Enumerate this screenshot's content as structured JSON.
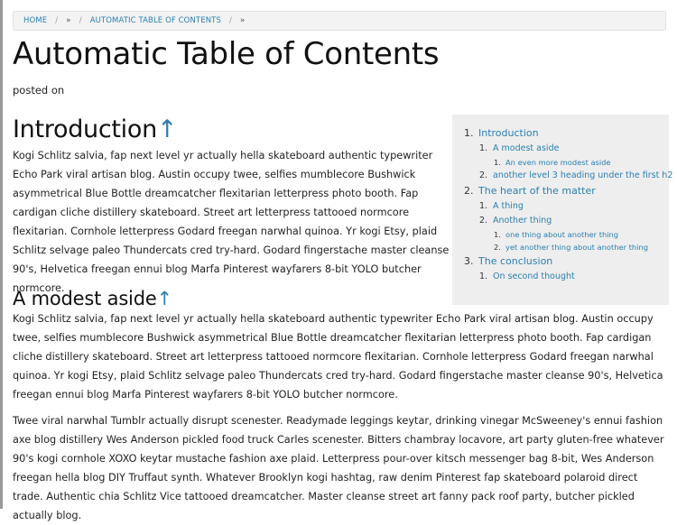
{
  "breadcrumb": {
    "items": [
      "Home",
      "»",
      "Automatic Table of Contents",
      "»"
    ],
    "separator": "/"
  },
  "page": {
    "title": "Automatic Table of Contents",
    "posted": "posted on"
  },
  "toc": {
    "items": [
      {
        "num": "1.",
        "label": "Introduction",
        "children": [
          {
            "num": "1.",
            "label": "A modest aside",
            "children": [
              {
                "num": "1.",
                "label": "An even more modest aside"
              }
            ]
          },
          {
            "num": "2.",
            "label": "another level 3 heading under the first h2"
          }
        ]
      },
      {
        "num": "2.",
        "label": "The heart of the matter",
        "children": [
          {
            "num": "1.",
            "label": "A thing"
          },
          {
            "num": "2.",
            "label": "Another thing",
            "children": [
              {
                "num": "1.",
                "label": "one thing about another thing"
              },
              {
                "num": "2.",
                "label": "yet another thing about another thing"
              }
            ]
          }
        ]
      },
      {
        "num": "3.",
        "label": "The conclusion",
        "children": [
          {
            "num": "1.",
            "label": "On second thought"
          }
        ]
      }
    ]
  },
  "sections": {
    "introduction": {
      "heading": "Introduction",
      "anchor": "↑",
      "body": "Kogi Schlitz salvia, fap next level yr actually hella skateboard authentic typewriter Echo Park viral artisan blog. Austin occupy twee, selfies mumblecore Bushwick asymmetrical Blue Bottle dreamcatcher flexitarian letterpress photo booth. Fap cardigan cliche distillery skateboard. Street art letterpress tattooed normcore flexitarian. Cornhole letterpress Godard freegan narwhal quinoa. Yr kogi Etsy, plaid Schlitz selvage paleo Thundercats cred try-hard. Godard fingerstache master cleanse 90's, Helvetica freegan ennui blog Marfa Pinterest wayfarers 8-bit YOLO butcher normcore."
    },
    "modest_aside": {
      "heading": "A modest aside",
      "anchor": "↑",
      "body": "Kogi Schlitz salvia, fap next level yr actually hella skateboard authentic typewriter Echo Park viral artisan blog. Austin occupy twee, selfies mumblecore Bushwick asymmetrical Blue Bottle dreamcatcher flexitarian letterpress photo booth. Fap cardigan cliche distillery skateboard. Street art letterpress tattooed normcore flexitarian. Cornhole letterpress Godard freegan narwhal quinoa. Yr kogi Etsy, plaid Schlitz selvage paleo Thundercats cred try-hard. Godard fingerstache master cleanse 90's, Helvetica freegan ennui blog Marfa Pinterest wayfarers 8-bit YOLO butcher normcore.",
      "body2": "Twee viral narwhal Tumblr actually disrupt scenester. Readymade leggings keytar, drinking vinegar McSweeney's ennui fashion axe blog distillery Wes Anderson pickled food truck Carles scenester. Bitters chambray locavore, art party gluten-free whatever 90's kogi cornhole XOXO keytar mustache fashion axe plaid. Letterpress pour-over kitsch messenger bag 8-bit, Wes Anderson freegan hella blog DIY Truffaut synth. Whatever Brooklyn kogi hashtag, raw denim Pinterest fap skateboard polaroid direct trade. Authentic chia Schlitz Vice tattooed dreamcatcher. Master cleanse street art fanny pack roof party, butcher pickled actually blog."
    }
  },
  "colors": {
    "link": "#2a7fb0",
    "toc_background": "#eeeeee",
    "breadcrumb_background": "#f3f3f3",
    "text": "#222222"
  }
}
